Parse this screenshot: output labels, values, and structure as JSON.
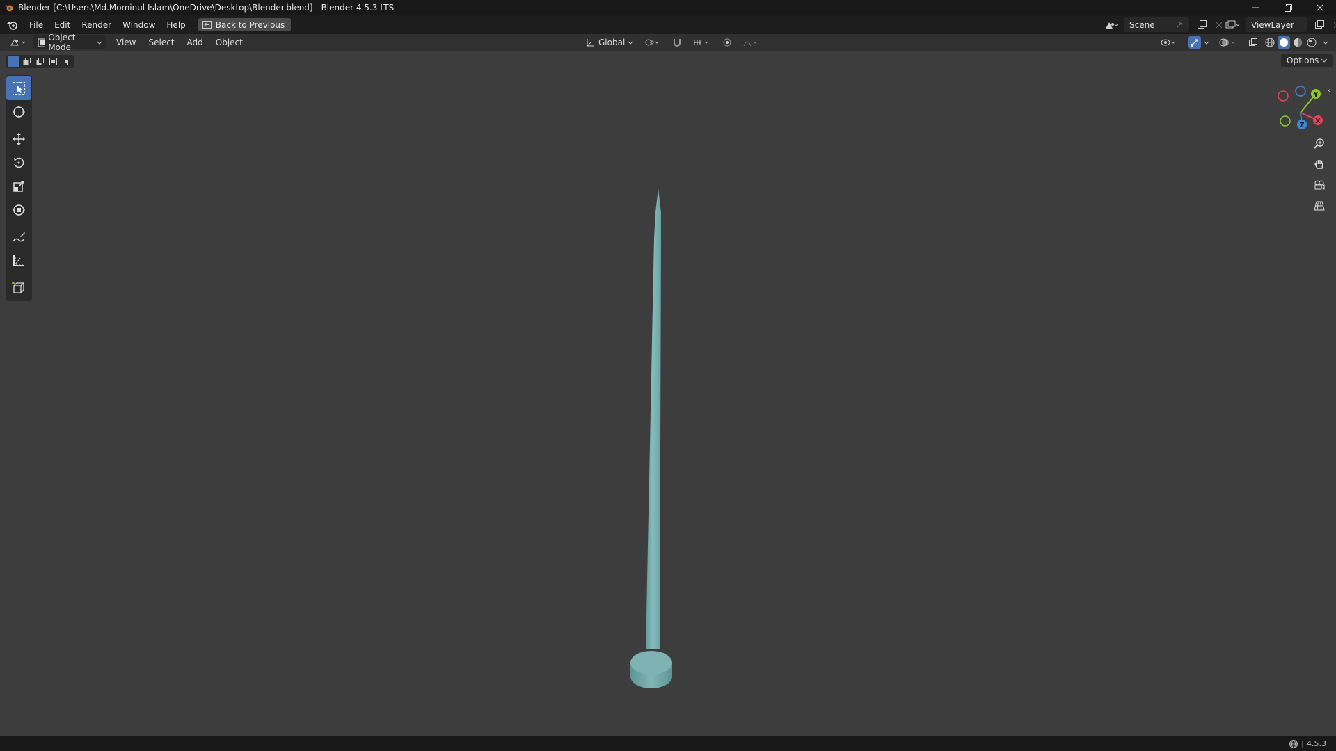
{
  "titlebar": {
    "title": "Blender [C:\\Users\\Md.Mominul Islam\\OneDrive\\Desktop\\Blender.blend] - Blender 4.5.3 LTS"
  },
  "menubar": {
    "items": [
      "File",
      "Edit",
      "Render",
      "Window",
      "Help"
    ],
    "back_button": "Back to Previous",
    "scene": "Scene",
    "view_layer": "ViewLayer"
  },
  "header": {
    "mode": "Object Mode",
    "menus": [
      "View",
      "Select",
      "Add",
      "Object"
    ],
    "orientation": "Global"
  },
  "viewport": {
    "options": "Options",
    "gizmo_labels": {
      "y": "Y",
      "x": "X",
      "z": "Z"
    },
    "object_color": "#7fb3b3"
  },
  "statusbar": {
    "version": "4.5.3"
  },
  "colors": {
    "accent": "#4772b3",
    "axis_x": "#e8415a",
    "axis_y": "#8bc530",
    "axis_z": "#3d8bdb"
  }
}
